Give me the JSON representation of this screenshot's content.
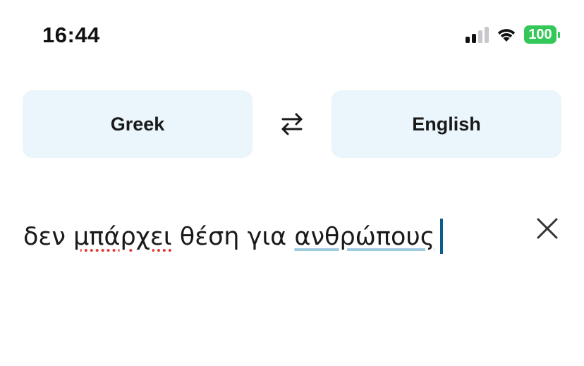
{
  "status_bar": {
    "time": "16:44",
    "battery": "100",
    "icons": [
      "cellular-signal-icon",
      "wifi-icon",
      "battery-icon"
    ],
    "battery_color": "#34c759"
  },
  "language_selector": {
    "source_language": "Greek",
    "target_language": "English",
    "swap_icon": "swap-arrows-icon",
    "button_background": "#eaf6fb"
  },
  "input": {
    "words": [
      {
        "text": "δεν",
        "mark": "none"
      },
      {
        "text": "μπάρχει",
        "mark": "spelling-error"
      },
      {
        "text": "θέση",
        "mark": "none"
      },
      {
        "text": "για",
        "mark": "none"
      },
      {
        "text": "ανθρώπους",
        "mark": "suggestion"
      }
    ],
    "clear_icon": "close-icon",
    "caret_color": "#0a5c8a"
  }
}
